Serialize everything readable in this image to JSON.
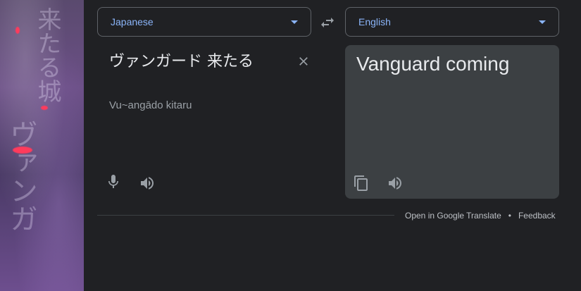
{
  "source_language": {
    "label": "Japanese"
  },
  "target_language": {
    "label": "English"
  },
  "source": {
    "text": "ヴァンガード 来たる",
    "romanization": "Vu~angādo kitaru"
  },
  "target": {
    "text": "Vanguard coming"
  },
  "footer": {
    "open_link": "Open in Google Translate",
    "separator": "•",
    "feedback_link": "Feedback"
  },
  "icons": {
    "caret": "chevron-down-icon",
    "swap": "swap-icon",
    "clear": "close-icon",
    "mic": "microphone-icon",
    "speaker": "speaker-icon",
    "copy": "copy-icon"
  },
  "colors": {
    "background": "#202124",
    "accent": "#8ab4f8",
    "panel": "#3c4043",
    "text": "#e8eaed",
    "muted": "#9aa0a6"
  }
}
